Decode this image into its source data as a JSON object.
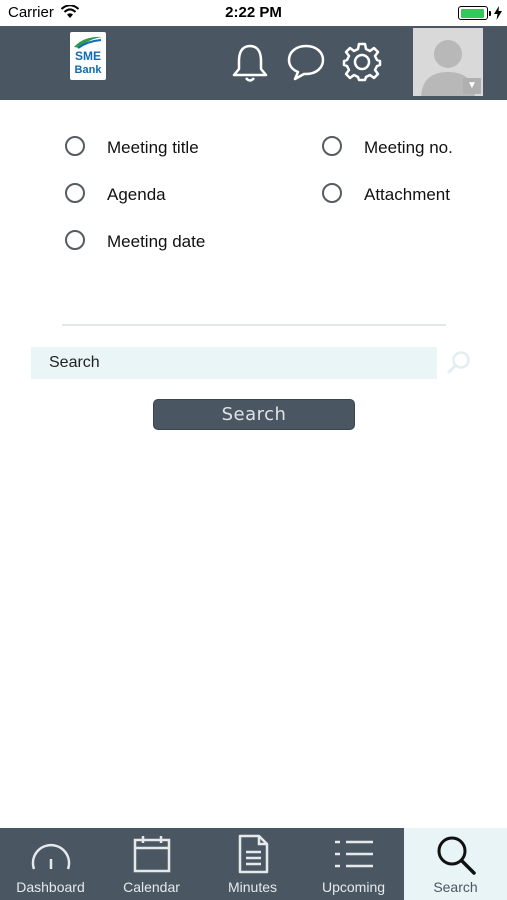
{
  "status_bar": {
    "carrier": "Carrier",
    "time": "2:22 PM",
    "battery_level": 1.0
  },
  "header": {
    "logo": {
      "line1": "SME",
      "line2": "Bank"
    },
    "icons": [
      "bell-icon",
      "chat-icon",
      "gear-icon"
    ],
    "accent_color": "#4a5763"
  },
  "filters": {
    "options": [
      {
        "label": "Meeting title",
        "selected": false
      },
      {
        "label": "Meeting no.",
        "selected": false
      },
      {
        "label": "Agenda",
        "selected": false
      },
      {
        "label": "Attachment",
        "selected": false
      },
      {
        "label": "Meeting date",
        "selected": false
      }
    ]
  },
  "search": {
    "placeholder": "Search",
    "button_label": "Search"
  },
  "tab_bar": {
    "active_tab": "Search",
    "tabs": [
      {
        "label": "Dashboard",
        "icon": "gauge-icon"
      },
      {
        "label": "Calendar",
        "icon": "calendar-icon"
      },
      {
        "label": "Minutes",
        "icon": "document-icon"
      },
      {
        "label": "Upcoming",
        "icon": "list-icon"
      },
      {
        "label": "Search",
        "icon": "search-icon"
      }
    ]
  }
}
